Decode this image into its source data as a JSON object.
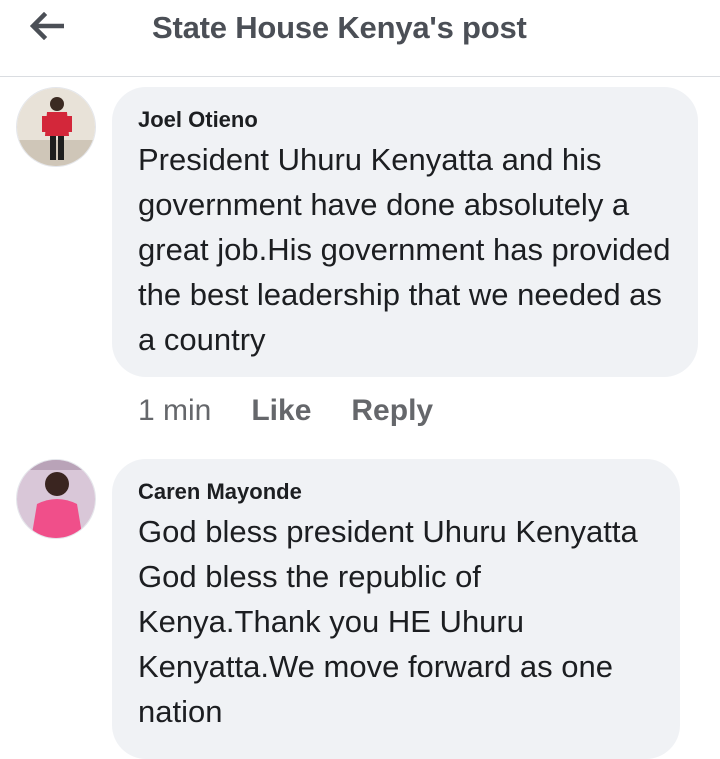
{
  "header": {
    "back_icon": "arrow-left-icon",
    "title": "State House Kenya's post"
  },
  "comments": [
    {
      "author": "Joel Otieno",
      "text": "President Uhuru Kenyatta and his government have done absolutely a great job.His government has provided the best leadership that we needed as a country",
      "time": "1 min",
      "like_label": "Like",
      "reply_label": "Reply",
      "avatar_icon": "user-avatar-icon"
    },
    {
      "author": "Caren Mayonde",
      "text": "God bless president Uhuru Kenyatta God bless the republic of Kenya.Thank you HE Uhuru Kenyatta.We move forward as one nation",
      "avatar_icon": "user-avatar-icon"
    }
  ],
  "colors": {
    "bubble": "#f0f2f5",
    "meta_text": "#65676b",
    "title_text": "#4b4f56"
  }
}
